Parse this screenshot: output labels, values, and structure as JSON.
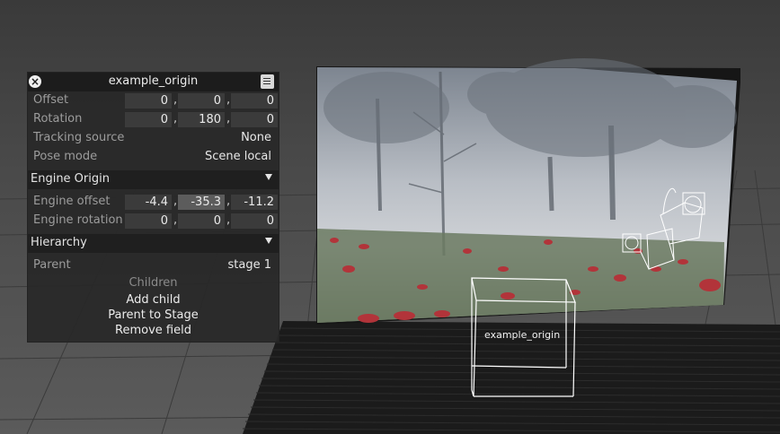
{
  "panel": {
    "title": "example_origin",
    "rows": {
      "offset": {
        "label": "Offset",
        "values": [
          "0",
          "0",
          "0"
        ]
      },
      "rotation": {
        "label": "Rotation",
        "values": [
          "0",
          "180",
          "0"
        ]
      },
      "tracking_source": {
        "label": "Tracking source",
        "value": "None"
      },
      "pose_mode": {
        "label": "Pose mode",
        "value": "Scene local"
      }
    },
    "engine_origin": {
      "header": "Engine Origin",
      "engine_offset": {
        "label": "Engine offset",
        "values": [
          "-4.4",
          "-35.3",
          "-11.2"
        ]
      },
      "engine_rotation": {
        "label": "Engine rotation",
        "values": [
          "0",
          "0",
          "0"
        ]
      }
    },
    "hierarchy": {
      "header": "Hierarchy",
      "parent_label": "Parent",
      "parent_value": "stage 1",
      "children_label": "Children",
      "add_child": "Add child",
      "parent_to_stage": "Parent to Stage",
      "remove_field": "Remove field"
    },
    "separator": ","
  },
  "scene": {
    "object_label": "example_origin"
  }
}
